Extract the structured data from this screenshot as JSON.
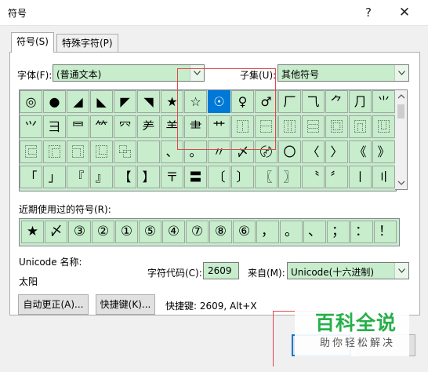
{
  "window": {
    "title": "符号",
    "help_glyph": "?",
    "close_glyph": "✕"
  },
  "tabs": [
    {
      "label": "符号(S)"
    },
    {
      "label": "特殊字符(P)"
    }
  ],
  "font": {
    "label": "字体(F):",
    "value": "(普通文本)"
  },
  "subset": {
    "label": "子集(U):",
    "value": "其他符号"
  },
  "symbol_rows": [
    [
      "◎",
      "●",
      "◢",
      "◣",
      "◤",
      "◥",
      "★",
      "☆",
      "☉",
      "♀",
      "♂",
      "⼚",
      "⺄",
      "⺈",
      "⺆",
      "⺌"
    ],
    [
      "⺍",
      "⺕",
      "⺜",
      "⺮",
      "⺳",
      "⺶",
      "⺷",
      "⺻",
      "⺾",
      "⿰",
      "⿱",
      "⿲",
      "⿳",
      "⿴",
      "⿵",
      "⿶"
    ],
    [
      "⿷",
      "⿸",
      "⿹",
      "⿺",
      "⿻",
      "",
      "、",
      "。",
      "〃",
      "〆",
      "〄",
      "〇",
      "〈",
      "〉",
      "《",
      "》"
    ],
    [
      "「",
      "」",
      "『",
      "』",
      "【",
      "】",
      "〒",
      "〓",
      "〔",
      "〕",
      "〖",
      "〗",
      "〝",
      "〞",
      "〡",
      "〢"
    ]
  ],
  "selected_symbol": "☉",
  "recent": {
    "label": "近期使用过的符号(R):",
    "symbols": [
      "★",
      "〆",
      "③",
      "②",
      "①",
      "⑤",
      "④",
      "⑦",
      "⑧",
      "⑥",
      "，",
      "。",
      "、",
      "；",
      "：",
      "！"
    ]
  },
  "unicode_name": {
    "label": "Unicode 名称:",
    "value": "太阳"
  },
  "char_code": {
    "label": "字符代码(C):",
    "value": "2609"
  },
  "from": {
    "label": "来自(M):",
    "value": "Unicode(十六进制)"
  },
  "buttons": {
    "autocorrect": "自动更正(A)...",
    "shortcut_key": "快捷键(K)...",
    "shortcut_info": "快捷键: 2609, Alt+X"
  },
  "watermark": {
    "logo": "百科全说",
    "sub": "助你轻松解决"
  },
  "colors": {
    "cell_bg": "#c7edcc",
    "selected": "#0078d7",
    "highlight": "#e0474c",
    "watermark_green": "#27b04a"
  }
}
